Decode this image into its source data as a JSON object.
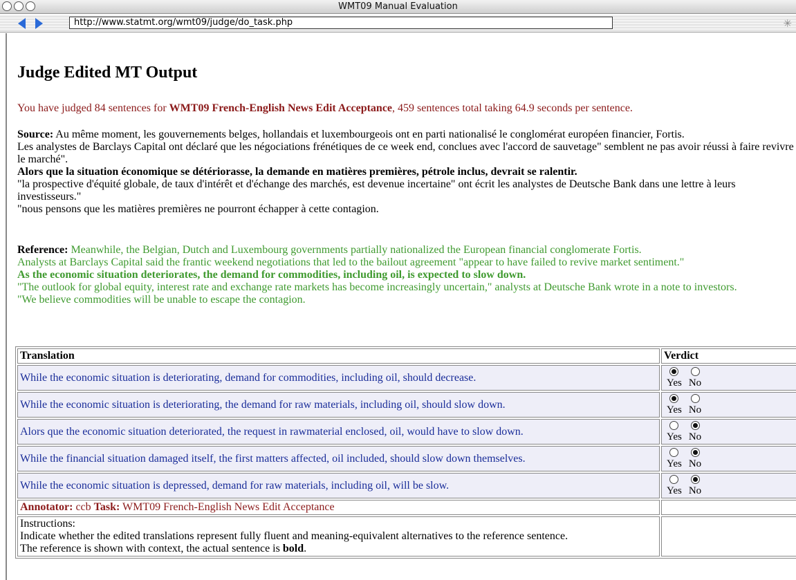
{
  "window": {
    "title": "WMT09 Manual Evaluation"
  },
  "toolbar": {
    "url": "http://www.statmt.org/wmt09/judge/do_task.php"
  },
  "page": {
    "heading": "Judge Edited MT Output",
    "stats": {
      "prefix": "You have judged 84 sentences for ",
      "task": "WMT09 French-English News Edit Acceptance",
      "suffix": ", 459 sentences total taking 64.9 seconds per sentence."
    },
    "source": {
      "label": "Source:",
      "lines": [
        " Au même moment, les gouvernements belges, hollandais et luxembourgeois ont en parti nationalisé le conglomérat européen financier, Fortis.",
        "Les analystes de Barclays Capital ont déclaré que les négociations frénétiques de ce week end, conclues avec l'accord de sauvetage\" semblent ne pas avoir réussi à faire revivre le marché\".",
        "Alors que la situation économique se détériorasse, la demande en matières premières, pétrole inclus, devrait se ralentir.",
        "\"la prospective d'équité globale, de taux d'intérêt et d'échange des marchés, est devenue incertaine\" ont écrit les analystes de Deutsche Bank dans une lettre à leurs investisseurs.\"",
        "\"nous pensons que les matières premières ne pourront échapper à cette contagion."
      ]
    },
    "reference": {
      "label": "Reference:",
      "lines": [
        " Meanwhile, the Belgian, Dutch and Luxembourg governments partially nationalized the European financial conglomerate Fortis.",
        "Analysts at Barclays Capital said the frantic weekend negotiations that led to the bailout agreement \"appear to have failed to revive market sentiment.\"",
        "As the economic situation deteriorates, the demand for commodities, including oil, is expected to slow down.",
        "\"The outlook for global equity, interest rate and exchange rate markets has become increasingly uncertain,\" analysts at Deutsche Bank wrote in a note to investors.",
        "\"We believe commodities will be unable to escape the contagion."
      ]
    },
    "table": {
      "headers": {
        "translation": "Translation",
        "verdict": "Verdict"
      },
      "yes_label": "Yes",
      "no_label": "No",
      "rows": [
        {
          "text": "While the economic situation is deteriorating, demand for commodities, including oil, should decrease.",
          "verdict": "yes"
        },
        {
          "text": "While the economic situation is deteriorating, the demand for raw materials, including oil, should slow down.",
          "verdict": "yes"
        },
        {
          "text": "Alors que the economic situation deteriorated, the request in rawmaterial enclosed, oil, would have to slow down.",
          "verdict": "no"
        },
        {
          "text": "While the financial situation damaged itself, the first matters affected, oil included, should slow down themselves.",
          "verdict": "no"
        },
        {
          "text": "While the economic situation is depressed, demand for raw materials, including oil, will be slow.",
          "verdict": "no"
        }
      ],
      "annotator": {
        "annotator_label": "Annotator:",
        "annotator_value": " ccb ",
        "task_label": "Task:",
        "task_value": " WMT09 French-English News Edit Acceptance"
      },
      "instructions": {
        "title": "Instructions:",
        "line1": "Indicate whether the edited translations represent fully fluent and meaning-equivalent alternatives to the reference sentence.",
        "line2_prefix": "The reference is shown with context, the actual sentence is ",
        "line2_bold": "bold",
        "line2_suffix": "."
      }
    }
  }
}
